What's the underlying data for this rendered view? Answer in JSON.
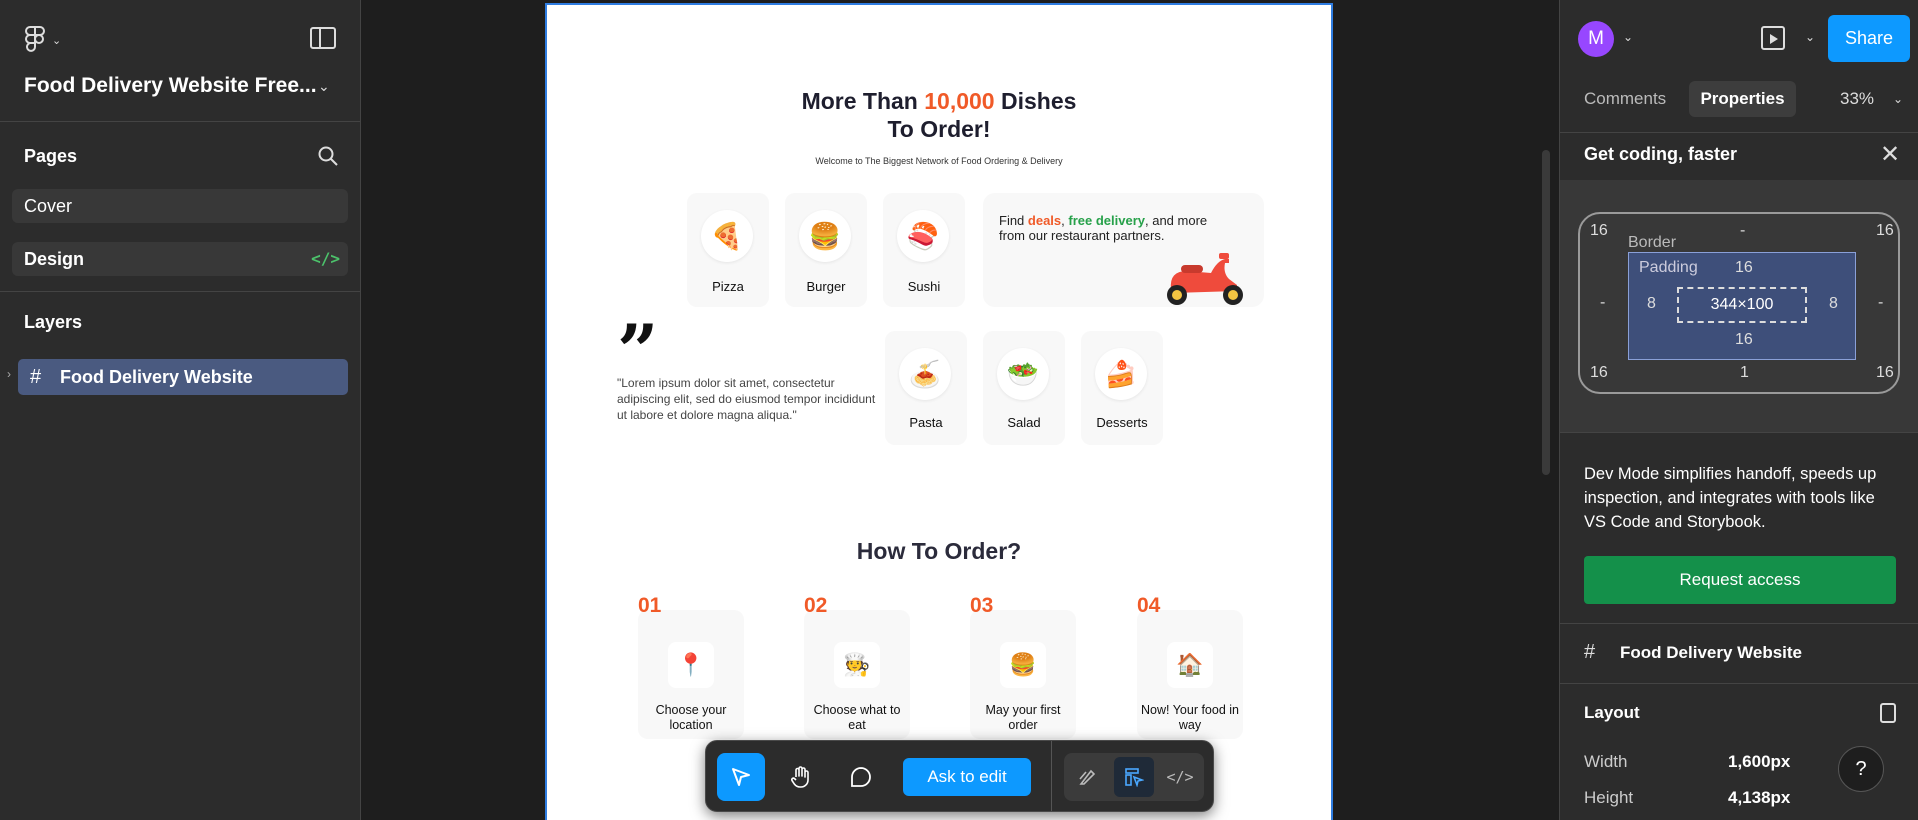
{
  "file": {
    "title": "Food Delivery Website Free..."
  },
  "pages": {
    "title": "Pages",
    "items": [
      {
        "label": "Cover"
      },
      {
        "label": "Design"
      }
    ]
  },
  "layers": {
    "title": "Layers",
    "items": [
      {
        "label": "Food Delivery Website"
      }
    ]
  },
  "design": {
    "hero": {
      "title_prefix": "More Than ",
      "title_highlight": "10,000",
      "title_suffix": " Dishes",
      "title_line2": "To Order!",
      "subtitle": "Welcome to The Biggest Network of Food Ordering & Delivery"
    },
    "categories": [
      {
        "label": "Pizza",
        "emoji": "🍕"
      },
      {
        "label": "Burger",
        "emoji": "🍔"
      },
      {
        "label": "Sushi",
        "emoji": "🍣"
      },
      {
        "label": "Pasta",
        "emoji": "🍝"
      },
      {
        "label": "Salad",
        "emoji": "🥗"
      },
      {
        "label": "Desserts",
        "emoji": "🍰"
      }
    ],
    "promo": {
      "find": "Find ",
      "deals": "deals",
      "comma": ", ",
      "free_delivery": "free delivery",
      "rest": ", and more from our restaurant partners."
    },
    "quote": {
      "mark": "”",
      "text": "\"Lorem ipsum dolor sit amet, consectetur adipiscing elit, sed do eiusmod tempor incididunt ut labore et dolore magna aliqua.\""
    },
    "how": {
      "title": "How To Order?",
      "steps": [
        {
          "num": "01",
          "label": "Choose your location",
          "emoji": "📍"
        },
        {
          "num": "02",
          "label": "Choose what to eat",
          "emoji": "🧑‍🍳"
        },
        {
          "num": "03",
          "label": "May your first order",
          "emoji": "🍔"
        },
        {
          "num": "04",
          "label": "Now! Your food in way",
          "emoji": "🏠"
        }
      ]
    }
  },
  "toolbar": {
    "ask_label": "Ask to edit"
  },
  "right": {
    "avatar": "M",
    "share_label": "Share",
    "tabs": [
      {
        "label": "Comments"
      },
      {
        "label": "Properties"
      }
    ],
    "zoom": "33%",
    "get_coding": {
      "title": "Get coding, faster",
      "box": {
        "border_label": "Border",
        "padding_label": "Padding",
        "size": "344×100",
        "corner_tl": "16",
        "corner_tr": "16",
        "corner_bl": "16",
        "corner_br": "16",
        "border_top": "-",
        "border_left": "-",
        "border_right": "-",
        "border_bottom": "1",
        "pad_top": "16",
        "pad_left": "8",
        "pad_right": "8",
        "pad_bottom": "16"
      },
      "description": "Dev Mode simplifies handoff, speeds up inspection, and integrates with tools like VS Code and Storybook.",
      "request_label": "Request access"
    },
    "selection": {
      "name": "Food Delivery Website"
    },
    "layout": {
      "title": "Layout",
      "width_label": "Width",
      "width_value": "1,600px",
      "height_label": "Height",
      "height_value": "4,138px"
    },
    "help": "?"
  },
  "colors": {
    "accent_blue": "#0d99ff",
    "brand_orange": "#f05a28",
    "green": "#27a14a",
    "request_green": "#14904a",
    "avatar_purple": "#9747ff"
  }
}
